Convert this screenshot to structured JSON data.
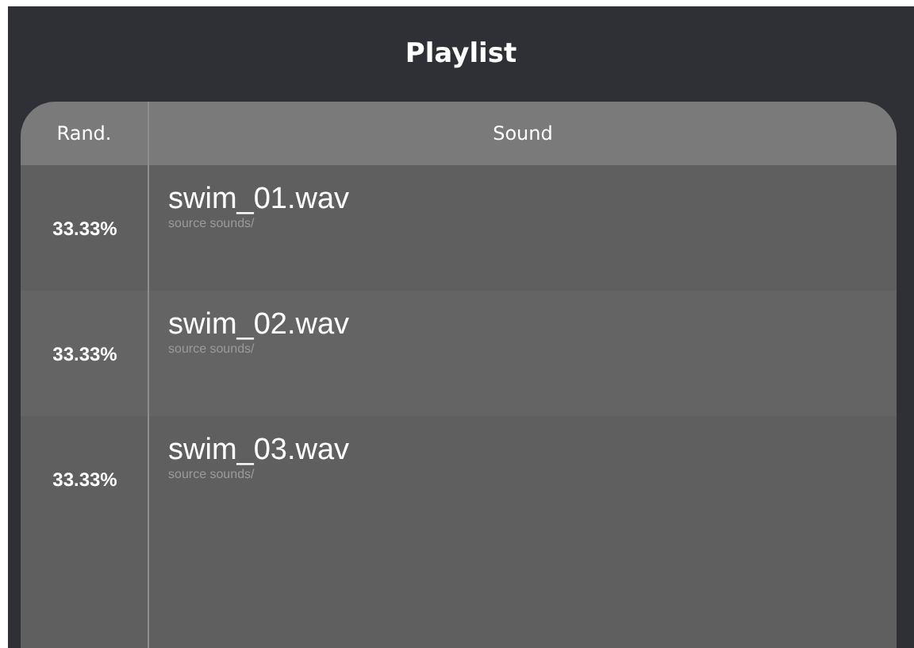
{
  "title": "Playlist",
  "table": {
    "columns": [
      "Rand.",
      "Sound"
    ],
    "rows": [
      {
        "rand": "33.33%",
        "name": "swim_01.wav",
        "folder": "source sounds/"
      },
      {
        "rand": "33.33%",
        "name": "swim_02.wav",
        "folder": "source sounds/"
      },
      {
        "rand": "33.33%",
        "name": "swim_03.wav",
        "folder": "source sounds/"
      }
    ]
  }
}
